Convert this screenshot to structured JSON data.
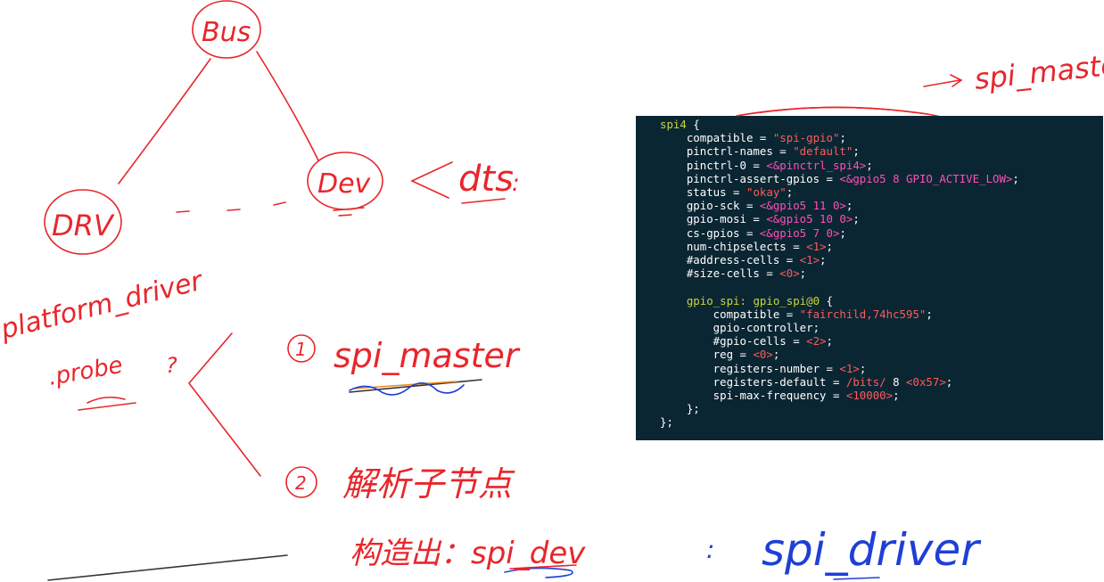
{
  "diagram": {
    "nodes": {
      "bus": "Bus",
      "drv": "DRV",
      "dev": "Dev"
    },
    "dts_label": "dts",
    "platform_driver": "platform_driver",
    "probe": ".probe",
    "probe_question": "?",
    "step1_num": "1",
    "step1_text": "spi_master",
    "step2_num": "2",
    "step2_text": "解析子节点",
    "construct_text": "构造出：spi_dev",
    "spi_driver_colon": ":",
    "spi_driver": "spi_driver",
    "top_right_label": "spi_master",
    "arrow": "→",
    "spi_dev_label_line1": "spi",
    "spi_dev_label_line2": "dev"
  },
  "code": {
    "lines": [
      [
        {
          "t": "spi4",
          "c": "k"
        },
        {
          "t": " {"
        }
      ],
      [
        {
          "t": "    compatible = "
        },
        {
          "t": "\"spi-gpio\"",
          "c": "s"
        },
        {
          "t": ";"
        }
      ],
      [
        {
          "t": "    pinctrl-names = "
        },
        {
          "t": "\"default\"",
          "c": "s"
        },
        {
          "t": ";"
        }
      ],
      [
        {
          "t": "    pinctrl-0 = "
        },
        {
          "t": "<&pinctrl_spi4>",
          "c": "m"
        },
        {
          "t": ";"
        }
      ],
      [
        {
          "t": "    pinctrl-assert-gpios = "
        },
        {
          "t": "<&gpio5 8 GPIO_ACTIVE_LOW>",
          "c": "m"
        },
        {
          "t": ";"
        }
      ],
      [
        {
          "t": "    status = "
        },
        {
          "t": "\"okay\"",
          "c": "s"
        },
        {
          "t": ";"
        }
      ],
      [
        {
          "t": "    gpio-sck = "
        },
        {
          "t": "<&gpio5 11 0>",
          "c": "m"
        },
        {
          "t": ";"
        }
      ],
      [
        {
          "t": "    gpio-mosi = "
        },
        {
          "t": "<&gpio5 10 0>",
          "c": "m"
        },
        {
          "t": ";"
        }
      ],
      [
        {
          "t": "    cs-gpios = "
        },
        {
          "t": "<&gpio5 7 0>",
          "c": "m"
        },
        {
          "t": ";"
        }
      ],
      [
        {
          "t": "    num-chipselects = "
        },
        {
          "t": "<1>",
          "c": "s"
        },
        {
          "t": ";"
        }
      ],
      [
        {
          "t": "    #address-cells = "
        },
        {
          "t": "<1>",
          "c": "s"
        },
        {
          "t": ";"
        }
      ],
      [
        {
          "t": "    #size-cells = "
        },
        {
          "t": "<0>",
          "c": "s"
        },
        {
          "t": ";"
        }
      ],
      [
        {
          "t": ""
        }
      ],
      [
        {
          "t": "    "
        },
        {
          "t": "gpio_spi: gpio_spi@0",
          "c": "k"
        },
        {
          "t": " {"
        }
      ],
      [
        {
          "t": "        compatible = "
        },
        {
          "t": "\"fairchild,74hc595\"",
          "c": "s"
        },
        {
          "t": ";"
        }
      ],
      [
        {
          "t": "        gpio-controller;"
        }
      ],
      [
        {
          "t": "        #gpio-cells = "
        },
        {
          "t": "<2>",
          "c": "s"
        },
        {
          "t": ";"
        }
      ],
      [
        {
          "t": "        reg = "
        },
        {
          "t": "<0>",
          "c": "s"
        },
        {
          "t": ";"
        }
      ],
      [
        {
          "t": "        registers-number = "
        },
        {
          "t": "<1>",
          "c": "s"
        },
        {
          "t": ";"
        }
      ],
      [
        {
          "t": "        registers-default = "
        },
        {
          "t": "/bits/",
          "c": "s"
        },
        {
          "t": " 8 "
        },
        {
          "t": "<0x57>",
          "c": "s"
        },
        {
          "t": ";"
        }
      ],
      [
        {
          "t": "        spi-max-frequency = "
        },
        {
          "t": "<10000>",
          "c": "s"
        },
        {
          "t": ";"
        }
      ],
      [
        {
          "t": "    };"
        }
      ],
      [
        {
          "t": "};"
        }
      ]
    ]
  },
  "colors": {
    "ink_red": "#e8262b",
    "ink_blue": "#1f3fd6",
    "ink_green": "#1aa02a",
    "ink_orange": "#f08a1c",
    "code_bg": "#0b2633"
  }
}
